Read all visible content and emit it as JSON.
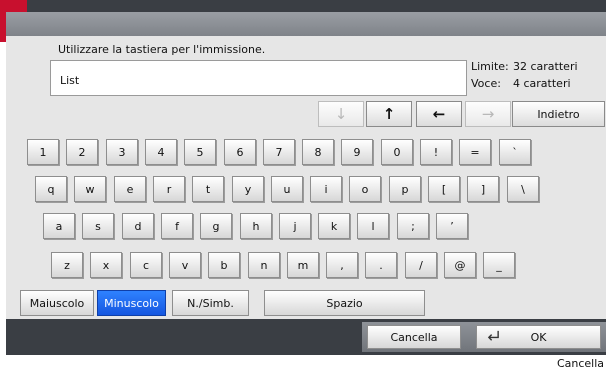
{
  "prompt": "Utilizzare la tastiera per l'immissione.",
  "input": {
    "value": "List"
  },
  "info": {
    "limit_label": "Limite:",
    "limit_value": "32 caratteri",
    "count_label": "Voce:",
    "count_value": "4 caratteri"
  },
  "nav": {
    "down": "↓",
    "up": "↑",
    "left": "←",
    "right": "→",
    "back": "Indietro"
  },
  "keys": {
    "row1": [
      "1",
      "2",
      "3",
      "4",
      "5",
      "6",
      "7",
      "8",
      "9",
      "0",
      "!",
      "=",
      "`"
    ],
    "row2": [
      "q",
      "w",
      "e",
      "r",
      "t",
      "y",
      "u",
      "i",
      "o",
      "p",
      "[",
      "]",
      "\\"
    ],
    "row3": [
      "a",
      "s",
      "d",
      "f",
      "g",
      "h",
      "j",
      "k",
      "l",
      ";",
      "’"
    ],
    "row4": [
      "z",
      "x",
      "c",
      "v",
      "b",
      "n",
      "m",
      ",",
      ".",
      "/",
      "@",
      "_"
    ]
  },
  "modes": {
    "uppercase": "Maiuscolo",
    "lowercase": "Minuscolo",
    "symbols": "N./Simb.",
    "space": "Spazio"
  },
  "actions": {
    "clear": "Cancella",
    "ok": "OK"
  },
  "callout": "Cancella"
}
